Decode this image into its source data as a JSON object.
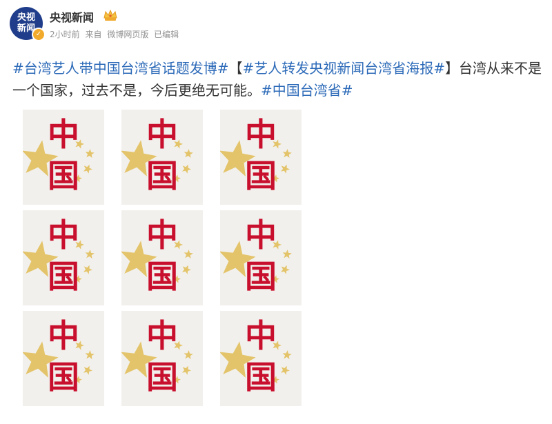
{
  "author": {
    "name": "央视新闻",
    "avatar_line1": "央视",
    "avatar_line2": "新闻"
  },
  "meta": {
    "time": "2小时前",
    "source_prefix": "来自",
    "source": "微博网页版",
    "edited": "已编辑"
  },
  "post": {
    "segments": [
      {
        "text": "#台湾艺人带中国台湾省话题发博#",
        "type": "tag"
      },
      {
        "text": "【",
        "type": "text"
      },
      {
        "text": "#艺人转发央视新闻台湾省海报#",
        "type": "tag"
      },
      {
        "text": "】台湾从来不是一个国家，过去不是，今后更绝无可能。",
        "type": "text"
      },
      {
        "text": "#中国台湾省#",
        "type": "tag"
      }
    ]
  },
  "images": {
    "count": 9,
    "poster_text": "中国",
    "colors": {
      "red": "#c8102e",
      "gold": "#e3c46a",
      "paper": "#f2f0ec"
    }
  },
  "colors": {
    "link": "#2c6ab8",
    "text": "#333333",
    "meta": "#939393",
    "avatar_bg": "#1f3d8a"
  }
}
